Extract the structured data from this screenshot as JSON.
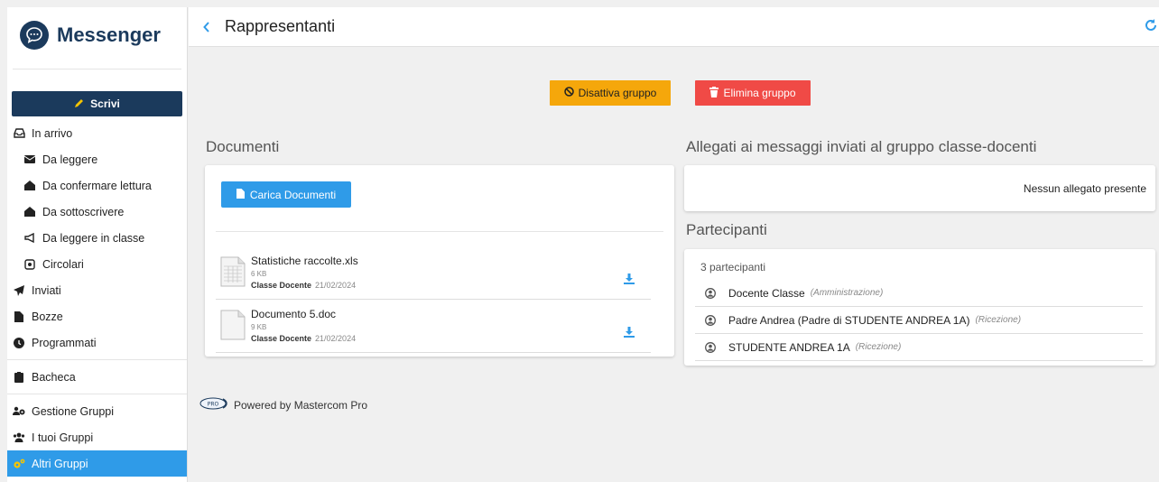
{
  "app": {
    "title": "Messenger"
  },
  "sidebar": {
    "write_label": "Scrivi",
    "items": [
      {
        "label": "In arrivo",
        "icon": "inbox-icon"
      },
      {
        "label": "Da leggere",
        "icon": "envelope-icon"
      },
      {
        "label": "Da confermare lettura",
        "icon": "envelope-open-icon"
      },
      {
        "label": "Da sottoscrivere",
        "icon": "envelope-open-icon"
      },
      {
        "label": "Da leggere in classe",
        "icon": "megaphone-icon"
      },
      {
        "label": "Circolari",
        "icon": "circular-icon"
      },
      {
        "label": "Inviati",
        "icon": "paper-plane-icon"
      },
      {
        "label": "Bozze",
        "icon": "file-icon"
      },
      {
        "label": "Programmati",
        "icon": "clock-icon"
      },
      {
        "label": "Bacheca",
        "icon": "clipboard-icon"
      },
      {
        "label": "Gestione Gruppi",
        "icon": "users-cog-icon"
      },
      {
        "label": "I tuoi Gruppi",
        "icon": "users-icon"
      },
      {
        "label": "Altri Gruppi",
        "icon": "cogs-icon"
      }
    ]
  },
  "header": {
    "title": "Rappresentanti"
  },
  "actions": {
    "deactivate_label": "Disattiva gruppo",
    "delete_label": "Elimina gruppo"
  },
  "documents": {
    "title": "Documenti",
    "upload_label": "Carica Documenti",
    "files": [
      {
        "name": "Statistiche raccolte.xls",
        "size": "6 KB",
        "owner": "Classe Docente",
        "date": "21/02/2024"
      },
      {
        "name": "Documento 5.doc",
        "size": "9 KB",
        "owner": "Classe Docente",
        "date": "21/02/2024"
      }
    ]
  },
  "attachments": {
    "title": "Allegati ai messaggi inviati al gruppo classe-docenti",
    "empty_text": "Nessun allegato presente"
  },
  "participants": {
    "title": "Partecipanti",
    "count_text": "3 partecipanti",
    "list": [
      {
        "name": "Docente Classe",
        "role": "(Amministrazione)"
      },
      {
        "name": "Padre Andrea (Padre di STUDENTE ANDREA 1A)",
        "role": "(Ricezione)"
      },
      {
        "name": "STUDENTE ANDREA 1A",
        "role": "(Ricezione)"
      }
    ]
  },
  "footer": {
    "powered_by": "Powered by Mastercom Pro",
    "logo_text": "PRO"
  },
  "colors": {
    "brand": "#1b3a5c",
    "accent": "#2f9be8",
    "warning": "#f5a70b",
    "danger": "#f04a46"
  }
}
